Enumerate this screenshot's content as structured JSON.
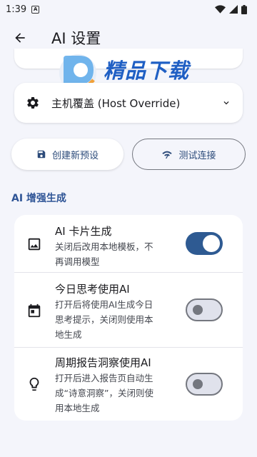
{
  "status_bar": {
    "time": "1:39",
    "app_icon": "A"
  },
  "app_bar": {
    "title": "AI 设置",
    "back_icon": "arrow-back-icon"
  },
  "watermark": {
    "name": "精品下载",
    "url": "www.j9p.com"
  },
  "dropdown": {
    "label": "主机覆盖 (Host Override)",
    "icon": "gear-icon"
  },
  "buttons": {
    "create_preset": "创建新预设",
    "test_connection": "测试连接"
  },
  "section": {
    "title": "AI 增强生成"
  },
  "settings": [
    {
      "title": "AI 卡片生成",
      "desc_lines": [
        "关闭后改用本地模板，不",
        "再调用模型"
      ],
      "enabled": true
    },
    {
      "title": "今日思考使用AI",
      "desc_lines": [
        "打开后将使用AI生成今日",
        "思考提示，关闭则使用本",
        "地生成"
      ],
      "enabled": false
    },
    {
      "title": "周期报告洞察使用AI",
      "desc_lines": [
        "打开后进入报告页自动生",
        "成“诗意洞察”，关闭则使",
        "用本地生成"
      ],
      "enabled": false
    }
  ],
  "colors": {
    "accent": "#2e5a92",
    "section": "#2e5496",
    "background": "#f4f5fb"
  }
}
